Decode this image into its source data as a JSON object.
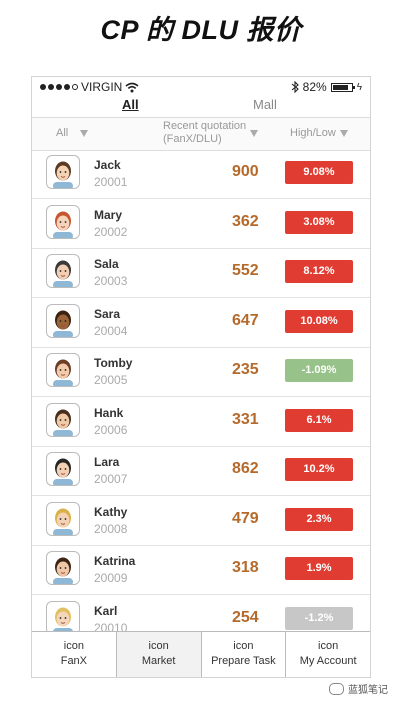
{
  "heading": "CP 的 DLU 报价",
  "status": {
    "carrier": "VIRGIN",
    "battery": "82%",
    "battery_level": 0.82
  },
  "tabs": [
    {
      "label": "All",
      "active": true
    },
    {
      "label": "Mall",
      "active": false
    }
  ],
  "columns": {
    "filter": "All",
    "quote_line1": "Recent quotation",
    "quote_line2": "(FanX/DLU)",
    "change": "High/Low"
  },
  "rows": [
    {
      "name": "Jack",
      "code": "20001",
      "value": "900",
      "change": "9.08%",
      "trend": "up"
    },
    {
      "name": "Mary",
      "code": "20002",
      "value": "362",
      "change": "3.08%",
      "trend": "up"
    },
    {
      "name": "Sala",
      "code": "20003",
      "value": "552",
      "change": "8.12%",
      "trend": "up"
    },
    {
      "name": "Sara",
      "code": "20004",
      "value": "647",
      "change": "10.08%",
      "trend": "up"
    },
    {
      "name": "Tomby",
      "code": "20005",
      "value": "235",
      "change": "-1.09%",
      "trend": "down"
    },
    {
      "name": "Hank",
      "code": "20006",
      "value": "331",
      "change": "6.1%",
      "trend": "up"
    },
    {
      "name": "Lara",
      "code": "20007",
      "value": "862",
      "change": "10.2%",
      "trend": "up"
    },
    {
      "name": "Kathy",
      "code": "20008",
      "value": "479",
      "change": "2.3%",
      "trend": "up"
    },
    {
      "name": "Katrina",
      "code": "20009",
      "value": "318",
      "change": "1.9%",
      "trend": "up"
    },
    {
      "name": "Karl",
      "code": "20010",
      "value": "254",
      "change": "-1.2%",
      "trend": "flat"
    }
  ],
  "colors": {
    "up": "#e03c32",
    "down": "#97c38a",
    "flat": "#c7c7c7",
    "value": "#b56a2c"
  },
  "tabbar": [
    {
      "icon": "icon",
      "label": "FanX",
      "selected": false
    },
    {
      "icon": "icon",
      "label": "Market",
      "selected": true
    },
    {
      "icon": "icon",
      "label": "Prepare Task",
      "selected": false
    },
    {
      "icon": "icon",
      "label": "My Account",
      "selected": false
    }
  ],
  "watermark": "蓝狐笔记"
}
